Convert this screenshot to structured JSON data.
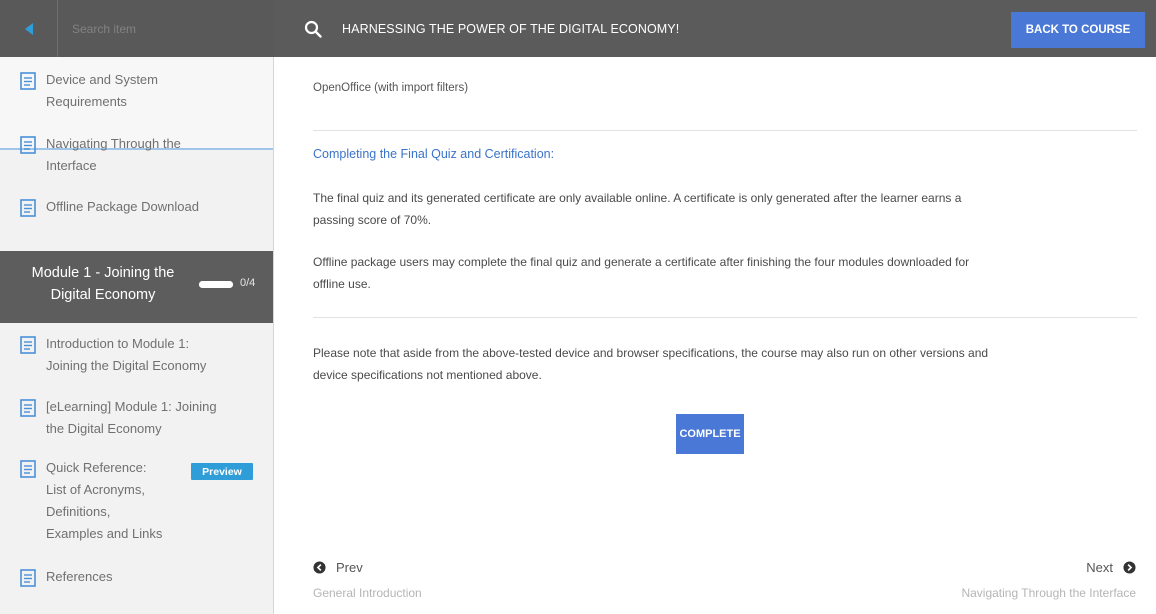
{
  "header": {
    "search_placeholder": "Search item",
    "course_title": "HARNESSING THE POWER OF THE DIGITAL ECONOMY!",
    "back_button": "BACK TO COURSE"
  },
  "sidebar": {
    "items_top": [
      {
        "label_line1": "Device and System",
        "label_line2": "Requirements",
        "active": true
      },
      {
        "label_line1": "Navigating Through the",
        "label_line2": "Interface"
      },
      {
        "label_line1": "Offline Package Download"
      }
    ],
    "module": {
      "title_line1": "Module 1 - Joining the",
      "title_line2": "Digital Economy",
      "count": "0/4",
      "progress": 0
    },
    "items_module": [
      {
        "label_line1": "Introduction to Module 1:",
        "label_line2": "Joining the Digital Economy"
      },
      {
        "label_line1": "[eLearning] Module 1: Joining",
        "label_line2": "the Digital Economy"
      },
      {
        "label_line1": "Quick Reference:",
        "label_line2": "List of Acronyms,",
        "label_line3": "Definitions,",
        "label_line4": "Examples and Links",
        "badge": "Preview"
      },
      {
        "label_line1": "References"
      }
    ]
  },
  "main": {
    "openoffice_text": "OpenOffice (with import filters)",
    "section_heading": "Completing the Final Quiz and Certification:",
    "para1_line1": "The final quiz and its generated certificate are only available online.  A certificate is only generated after the learner earns a",
    "para1_line2": "passing score of 70%.",
    "para2_line1": "Offline package users may complete the final quiz and generate a certificate after finishing the four modules downloaded for",
    "para2_line2": "offline use.",
    "para3_line1": "Please note that aside from the above-tested device and browser specifications, the course may also run on other versions and",
    "para3_line2": "device specifications not mentioned above.",
    "complete_button": "COMPLETE",
    "prev_label": "Prev",
    "prev_title": "General Introduction",
    "next_label": "Next",
    "next_title": "Navigating Through the Interface"
  },
  "colors": {
    "header_bg": "#5b5b5b",
    "accent_blue": "#4a78d6",
    "link_blue": "#3a73c9",
    "badge_blue": "#2f9ed8",
    "doc_icon_blue": "#4a90d9"
  }
}
